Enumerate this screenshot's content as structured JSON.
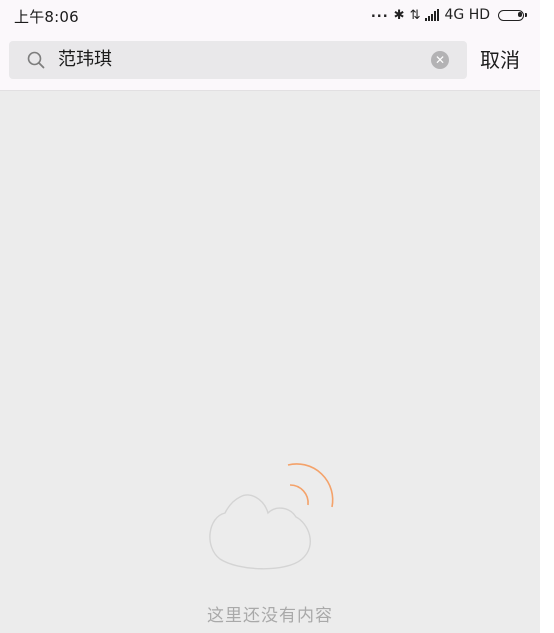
{
  "status_bar": {
    "time": "上午8:06",
    "dots": "...",
    "bluetooth_icon": "✱",
    "data_icon": "⇅",
    "signal_icon": "signal-bars",
    "network": "4G HD",
    "battery_icon": "battery-low"
  },
  "search": {
    "value": "范玮琪",
    "search_icon": "search-icon",
    "clear_icon": "clear-icon",
    "cancel_label": "取消"
  },
  "empty_state": {
    "message": "这里还没有内容",
    "accent_color": "#f4a26a",
    "line_color": "#d4d4d4"
  },
  "colors": {
    "header_bg": "#fbf8fb",
    "content_bg": "#ececec",
    "search_box_bg": "#e9e8ea"
  }
}
